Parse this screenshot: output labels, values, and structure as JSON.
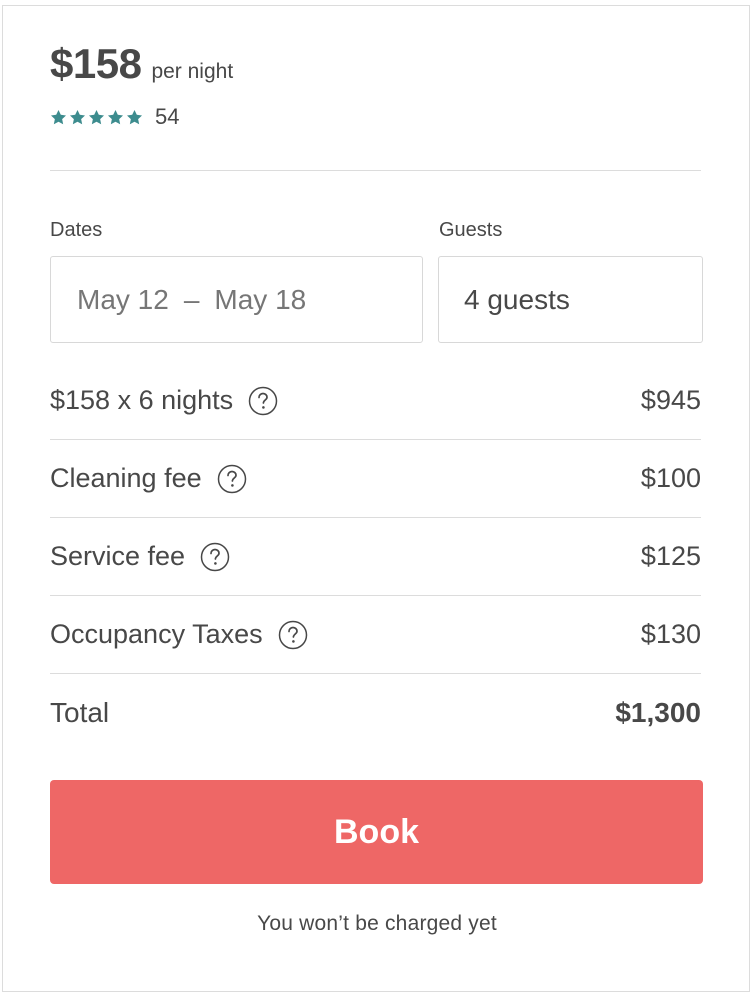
{
  "header": {
    "price": "$158",
    "price_unit": "per night",
    "rating_stars": 5,
    "review_count": "54",
    "star_color": "#3d8c8e"
  },
  "form": {
    "dates_label": "Dates",
    "check_in": "May 12",
    "date_separator": "–",
    "check_out": "May 18",
    "guests_label": "Guests",
    "guests_value": "4 guests"
  },
  "breakdown": [
    {
      "label": "$158 x 6 nights",
      "amount": "$945",
      "help_icon": "question-circle-icon"
    },
    {
      "label": "Cleaning fee",
      "amount": "$100",
      "help_icon": "question-circle-icon"
    },
    {
      "label": "Service fee",
      "amount": "$125",
      "help_icon": "question-circle-icon"
    },
    {
      "label": "Occupancy Taxes",
      "amount": "$130",
      "help_icon": "question-circle-icon"
    }
  ],
  "total": {
    "label": "Total",
    "amount": "$1,300"
  },
  "actions": {
    "book_label": "Book",
    "book_color": "#ee6766"
  },
  "footnote": "You won’t be charged yet"
}
